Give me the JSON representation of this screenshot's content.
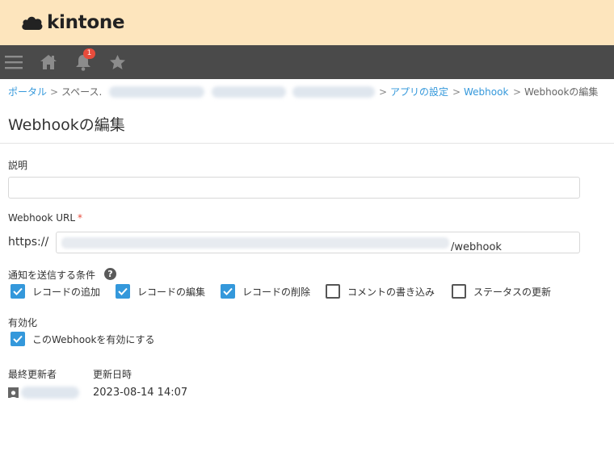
{
  "header": {
    "brand": "kintone"
  },
  "nav": {
    "notification_count": "1"
  },
  "breadcrumb": {
    "portal": "ポータル",
    "space": "スペース.",
    "app_settings": "アプリの設定",
    "webhook": "Webhook",
    "current": "Webhookの編集",
    "separator": ">"
  },
  "page": {
    "title": "Webhookの編集"
  },
  "form": {
    "description_label": "説明",
    "description_value": "",
    "url_label": "Webhook URL",
    "url_required": "*",
    "url_prefix": "https://",
    "url_suffix": "/webhook",
    "conditions_label": "通知を送信する条件",
    "help_glyph": "?",
    "conditions": [
      {
        "label": "レコードの追加",
        "checked": true
      },
      {
        "label": "レコードの編集",
        "checked": true
      },
      {
        "label": "レコードの削除",
        "checked": true
      },
      {
        "label": "コメントの書き込み",
        "checked": false
      },
      {
        "label": "ステータスの更新",
        "checked": false
      }
    ],
    "enabled_label": "有効化",
    "enabled_checkbox_label": "このWebhookを有効にする",
    "enabled_checked": true
  },
  "meta": {
    "last_updated_by_label": "最終更新者",
    "updated_at_label": "更新日時",
    "updated_at_value": "2023-08-14 14:07"
  },
  "colors": {
    "brand_bar": "#fde5bd",
    "nav_bar": "#4a4a4a",
    "accent": "#3498db",
    "required": "#e74c3c"
  },
  "icons": [
    "cloud-logo-icon",
    "menu-icon",
    "home-icon",
    "bell-icon",
    "star-icon",
    "help-icon",
    "check-icon",
    "user-icon"
  ]
}
